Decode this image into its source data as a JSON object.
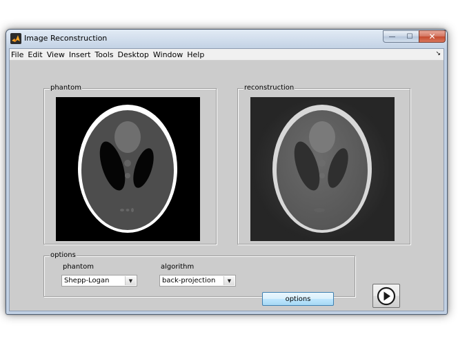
{
  "window": {
    "title": "Image Reconstruction",
    "controls": {
      "minimize": "—",
      "maximize": "☐",
      "close": "✕"
    }
  },
  "menubar": {
    "items": [
      "File",
      "Edit",
      "View",
      "Insert",
      "Tools",
      "Desktop",
      "Window",
      "Help"
    ],
    "overflow_arrow": "↘"
  },
  "panels": {
    "phantom": {
      "title": "phantom"
    },
    "reconstruction": {
      "title": "reconstruction"
    },
    "options": {
      "title": "options",
      "phantom_label": "phantom",
      "phantom_value": "Shepp-Logan",
      "algorithm_label": "algorithm",
      "algorithm_value": "back-projection",
      "options_button": "options"
    }
  },
  "icons": {
    "app": "matlab-logo-icon",
    "dropdown": "▼",
    "run": "play-icon"
  },
  "colors": {
    "figure_bg": "#cccccc",
    "axes_bg": "#000000",
    "accent_button": "#bee6fd"
  }
}
